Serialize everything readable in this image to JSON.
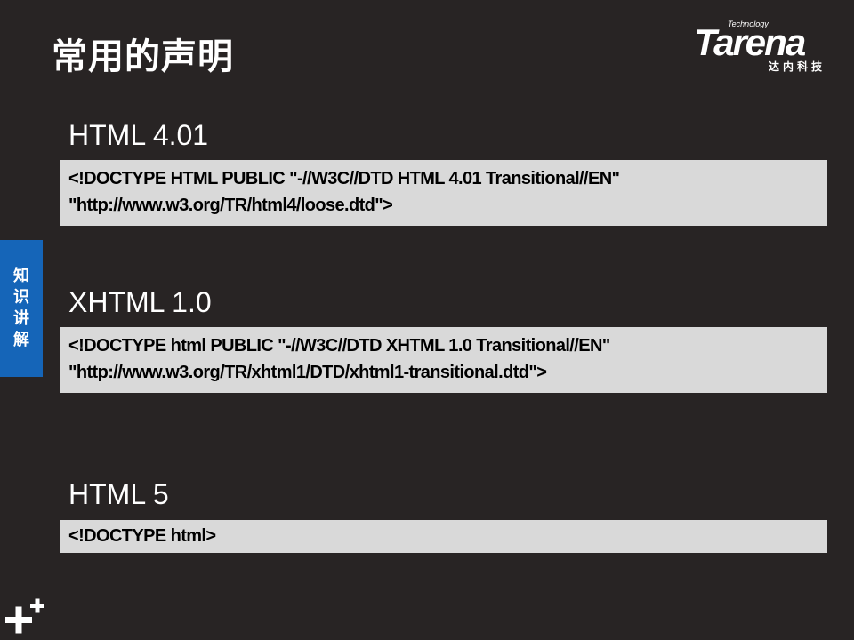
{
  "slide": {
    "title": "常用的声明",
    "side_tab": [
      "知",
      "识",
      "讲",
      "解"
    ]
  },
  "logo": {
    "technology": "Technology",
    "brand": "Tarena",
    "chinese": "达内科技"
  },
  "sections": [
    {
      "heading": "HTML 4.01",
      "lines": [
        "<!DOCTYPE HTML PUBLIC \"-//W3C//DTD HTML 4.01 Transitional//EN\"",
        "\"http://www.w3.org/TR/html4/loose.dtd\">"
      ]
    },
    {
      "heading": "XHTML 1.0",
      "lines": [
        "<!DOCTYPE html PUBLIC \"-//W3C//DTD XHTML 1.0 Transitional//EN\"",
        "\"http://www.w3.org/TR/xhtml1/DTD/xhtml1-transitional.dtd\">"
      ]
    },
    {
      "heading": "HTML 5",
      "lines": [
        "<!DOCTYPE html>"
      ]
    }
  ],
  "colors": {
    "background": "#282424",
    "side_tab": "#1565b8",
    "code_box": "#d9d9d9"
  },
  "icons": {
    "corner": "plus-icon"
  }
}
